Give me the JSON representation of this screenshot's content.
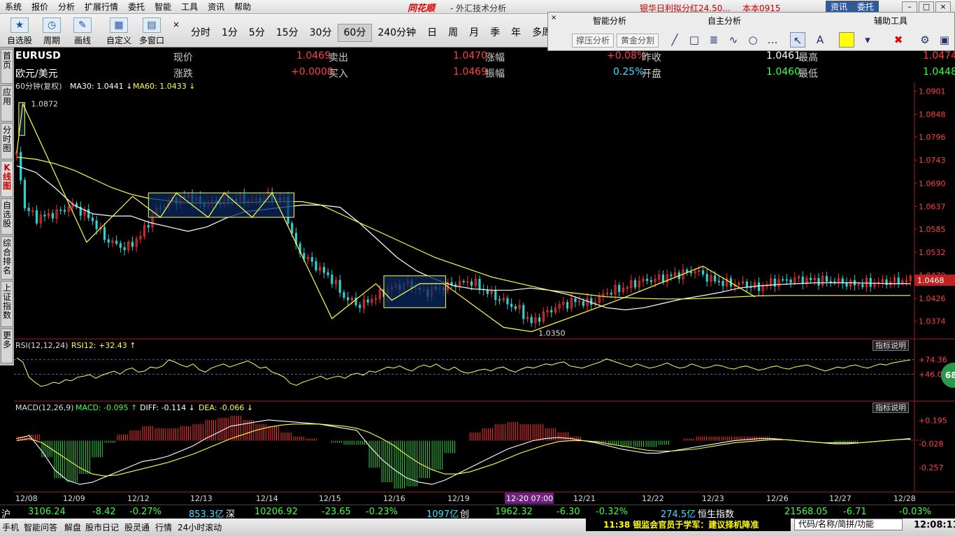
{
  "menu": [
    "系统",
    "报价",
    "分析",
    "扩展行情",
    "委托",
    "智能",
    "工具",
    "资讯",
    "帮助"
  ],
  "brand": "同花顺",
  "app_title": "- 外汇技术分析",
  "top_ticker": "银华日利拟分红24.50...",
  "top_ticker2": "本本0915",
  "top_buttons": {
    "news": "资讯",
    "order": "委托"
  },
  "toolbar": {
    "tools": [
      "自选股",
      "周期",
      "画线",
      "自定义",
      "多窗口"
    ],
    "periods": [
      "分时",
      "1分",
      "5分",
      "15分",
      "30分",
      "60分",
      "240分钟",
      "日",
      "周",
      "月",
      "季",
      "年",
      "多周期"
    ],
    "active_period": "60分"
  },
  "panel": {
    "headers": [
      "智能分析",
      "自主分析",
      "辅助工具"
    ],
    "buttons": [
      "撑压分析",
      "黄金分割"
    ]
  },
  "left_tabs": [
    "首页",
    "应用",
    "分时图",
    "K线图",
    "自选股",
    "综合排名",
    "上证指数",
    "更多"
  ],
  "quote": {
    "symbol": "EURUSD",
    "name": "欧元/美元",
    "row1": {
      "l1": "现价",
      "v1": "1.0469",
      "l2": "卖出",
      "v2": "1.0470",
      "l3": "涨幅",
      "v3": "+0.08%",
      "l4": "昨收",
      "v4": "1.0461",
      "l5": "最高",
      "v5": "1.0474"
    },
    "row2": {
      "l1": "涨跌",
      "v1": "+0.0008",
      "l2": "买入",
      "v2": "1.0469",
      "l3": "振幅",
      "v3": "0.25%",
      "l4": "开盘",
      "v4": "1.0460",
      "l5": "最低",
      "v5": "1.0448"
    }
  },
  "chart_labels": {
    "kline_title": "60分钟(复权)",
    "ma30": "MA30: 1.0441",
    "ma60": "MA60: 1.0433",
    "high_mark": "1.0872",
    "low_mark": "1.0350",
    "current_price": "1.0468",
    "rsi_title": "RSI(12,12,24)",
    "rsi_val": "RSI12: +32.43",
    "macd_title": "MACD(12,26,9)",
    "macd_val": "MACD: -0.095",
    "diff_val": "DIFF: -0.114",
    "dea_val": "DEA: -0.066",
    "indicator_btn": "指标说明",
    "rsi_badge": "68"
  },
  "chart_data": [
    {
      "type": "candlestick",
      "title": "60分钟(复权)",
      "price_ticks": [
        "1.0901",
        "1.0848",
        "1.0796",
        "1.0743",
        "1.0690",
        "1.0637",
        "1.0585",
        "1.0532",
        "1.0479",
        "1.0426",
        "1.0374"
      ],
      "ylim": [
        1.0335,
        1.0905
      ],
      "x_labels": [
        "12/08",
        "12/09",
        "12/12",
        "12/13",
        "12/14",
        "12/15",
        "12/16",
        "12/19",
        "12-20 07:00",
        "12/21",
        "12/22",
        "12/23",
        "12/26",
        "12/27",
        "12/28"
      ],
      "close_path": [
        [
          0,
          1.0755
        ],
        [
          1,
          1.0872
        ],
        [
          2,
          1.07
        ],
        [
          3,
          1.064
        ],
        [
          10,
          1.061
        ],
        [
          20,
          1.0622
        ],
        [
          28,
          1.064
        ],
        [
          37,
          1.061
        ],
        [
          45,
          1.056
        ],
        [
          55,
          1.054
        ],
        [
          62,
          1.057
        ],
        [
          70,
          1.063
        ],
        [
          78,
          1.065
        ],
        [
          86,
          1.066
        ],
        [
          94,
          1.064
        ],
        [
          102,
          1.065
        ],
        [
          110,
          1.0655
        ],
        [
          118,
          1.065
        ],
        [
          126,
          1.066
        ],
        [
          134,
          1.065
        ],
        [
          138,
          1.057
        ],
        [
          142,
          1.053
        ],
        [
          150,
          1.05
        ],
        [
          158,
          1.047
        ],
        [
          164,
          1.043
        ],
        [
          172,
          1.041
        ],
        [
          180,
          1.043
        ],
        [
          188,
          1.045
        ],
        [
          196,
          1.046
        ],
        [
          204,
          1.044
        ],
        [
          212,
          1.045
        ],
        [
          220,
          1.046
        ],
        [
          228,
          1.0465
        ],
        [
          236,
          1.044
        ],
        [
          244,
          1.042
        ],
        [
          252,
          1.04
        ],
        [
          258,
          1.037
        ],
        [
          264,
          1.039
        ],
        [
          272,
          1.041
        ],
        [
          280,
          1.042
        ],
        [
          288,
          1.0415
        ],
        [
          296,
          1.044
        ],
        [
          304,
          1.045
        ],
        [
          312,
          1.0465
        ],
        [
          320,
          1.047
        ],
        [
          330,
          1.048
        ],
        [
          340,
          1.049
        ],
        [
          348,
          1.047
        ],
        [
          356,
          1.046
        ],
        [
          364,
          1.046
        ],
        [
          372,
          1.045
        ],
        [
          380,
          1.0465
        ],
        [
          390,
          1.047
        ],
        [
          400,
          1.0468
        ],
        [
          410,
          1.0466
        ],
        [
          420,
          1.0458
        ],
        [
          430,
          1.0462
        ],
        [
          440,
          1.0466
        ],
        [
          448,
          1.0468
        ]
      ],
      "ma30": [
        1.073,
        1.0715,
        1.068,
        1.064,
        1.062,
        1.0615,
        1.0615,
        1.06,
        1.059,
        1.058,
        1.059,
        1.061,
        1.0625,
        1.063,
        1.0635,
        1.064,
        1.064,
        1.0635,
        1.06,
        1.056,
        1.052,
        1.049,
        1.047,
        1.0455,
        1.0448,
        1.0445,
        1.0445,
        1.045,
        1.0445,
        1.0435,
        1.042,
        1.0405,
        1.04,
        1.0405,
        1.0415,
        1.0425,
        1.0432,
        1.044,
        1.045,
        1.0455,
        1.0458,
        1.046,
        1.0462,
        1.0462,
        1.0462,
        1.0461,
        1.046,
        1.046
      ],
      "ma60": [
        1.075,
        1.0745,
        1.0735,
        1.072,
        1.07,
        1.068,
        1.0665,
        1.0655,
        1.065,
        1.0645,
        1.0645,
        1.0645,
        1.0646,
        1.0647,
        1.0648,
        1.0648,
        1.064,
        1.062,
        1.06,
        1.058,
        1.056,
        1.054,
        1.052,
        1.0505,
        1.049,
        1.0475,
        1.0465,
        1.0455,
        1.0445,
        1.044,
        1.0435,
        1.043,
        1.0428,
        1.0426,
        1.0425,
        1.0425,
        1.0426,
        1.0428,
        1.043,
        1.0432,
        1.0433,
        1.0433,
        1.0433,
        1.0433,
        1.0433,
        1.0433,
        1.0433,
        1.0433
      ],
      "zigzag": [
        [
          0,
          1.076
        ],
        [
          3,
          1.0872
        ],
        [
          35,
          1.0555
        ],
        [
          58,
          1.066
        ],
        [
          72,
          1.0612
        ],
        [
          80,
          1.0668
        ],
        [
          96,
          1.0612
        ],
        [
          104,
          1.0668
        ],
        [
          118,
          1.0612
        ],
        [
          128,
          1.0668
        ],
        [
          158,
          1.038
        ],
        [
          180,
          1.046
        ],
        [
          188,
          1.0422
        ],
        [
          202,
          1.046
        ],
        [
          214,
          1.046
        ],
        [
          244,
          1.036
        ],
        [
          258,
          1.035
        ],
        [
          300,
          1.042
        ],
        [
          344,
          1.05
        ],
        [
          370,
          1.043
        ]
      ],
      "boxes": [
        [
          1,
          1.0875,
          4,
          1.08
        ],
        [
          66,
          1.0668,
          139,
          1.0612
        ],
        [
          184,
          1.0478,
          215,
          1.0405
        ]
      ]
    },
    {
      "type": "line",
      "title": "RSI(12,12,24)",
      "y_ticks": [
        "+74.36",
        "+46.05"
      ],
      "ylim": [
        0,
        100
      ],
      "values": [
        78,
        70,
        40,
        30,
        22,
        25,
        30,
        28,
        35,
        33,
        40,
        42,
        45,
        38,
        44,
        48,
        52,
        46,
        55,
        58,
        50,
        52,
        60,
        58,
        62,
        74,
        70,
        64,
        60,
        66,
        55,
        50,
        58,
        62,
        66,
        60,
        64,
        68,
        72,
        66,
        58,
        60,
        50,
        46,
        40,
        28,
        24,
        30,
        34,
        38,
        42,
        36,
        40,
        42,
        38,
        45,
        48,
        44,
        52,
        50,
        55,
        60,
        58,
        62,
        56,
        52,
        60,
        64,
        60,
        66,
        58,
        54,
        60,
        52,
        48,
        50,
        54,
        56,
        52,
        58,
        60,
        54,
        50,
        56,
        60,
        58,
        62,
        66,
        64,
        68,
        70,
        62,
        60,
        58,
        62,
        66,
        70,
        76,
        72,
        68,
        64,
        60,
        66,
        62,
        58,
        60,
        64,
        68,
        62,
        58,
        60,
        66,
        62,
        58,
        60,
        64,
        62,
        58,
        56,
        60,
        62,
        58,
        54,
        56,
        60,
        62,
        58,
        56,
        60,
        62,
        64,
        60,
        56,
        52,
        56,
        60,
        58,
        62,
        64,
        60,
        58,
        62,
        66,
        64,
        68,
        70,
        72,
        74
      ]
    },
    {
      "type": "bar+line",
      "title": "MACD(12,26,9)",
      "y_ticks": [
        "+0.195",
        "-0.028",
        "-0.257"
      ],
      "ylim": [
        -0.46,
        0.3
      ],
      "diff": [
        0.02,
        0.05,
        -0.1,
        -0.28,
        -0.38,
        -0.42,
        -0.4,
        -0.35,
        -0.3,
        -0.25,
        -0.2,
        -0.18,
        -0.15,
        -0.1,
        -0.05,
        0.02,
        0.08,
        0.14,
        0.16,
        0.18,
        0.2,
        0.19,
        0.18,
        0.17,
        0.16,
        0.14,
        0.12,
        0.1,
        -0.05,
        -0.18,
        -0.28,
        -0.36,
        -0.4,
        -0.42,
        -0.38,
        -0.32,
        -0.26,
        -0.2,
        -0.14,
        -0.08,
        -0.04,
        0.0,
        0.02,
        0.03,
        0.02,
        0.0,
        -0.02,
        -0.05,
        -0.08,
        -0.1,
        -0.12,
        -0.12,
        -0.1,
        -0.08,
        -0.06,
        -0.04,
        -0.02,
        0.0,
        0.01,
        0.02,
        0.02,
        0.01,
        0.0,
        -0.01,
        -0.02,
        -0.03,
        -0.03,
        -0.02,
        -0.01,
        0.0,
        0.01,
        0.02
      ],
      "dea": [
        0.0,
        0.02,
        -0.02,
        -0.1,
        -0.18,
        -0.26,
        -0.32,
        -0.34,
        -0.33,
        -0.3,
        -0.27,
        -0.24,
        -0.21,
        -0.17,
        -0.13,
        -0.08,
        -0.03,
        0.02,
        0.06,
        0.1,
        0.13,
        0.15,
        0.16,
        0.16,
        0.16,
        0.15,
        0.14,
        0.12,
        0.08,
        0.02,
        -0.05,
        -0.14,
        -0.22,
        -0.28,
        -0.32,
        -0.32,
        -0.3,
        -0.26,
        -0.22,
        -0.17,
        -0.12,
        -0.08,
        -0.04,
        -0.01,
        0.0,
        0.0,
        -0.01,
        -0.03,
        -0.05,
        -0.07,
        -0.09,
        -0.1,
        -0.1,
        -0.09,
        -0.08,
        -0.06,
        -0.04,
        -0.02,
        -0.01,
        0.0,
        0.01,
        0.01,
        0.0,
        -0.01,
        -0.02,
        -0.02,
        -0.02,
        -0.02,
        -0.01,
        0.0,
        0.01,
        0.015
      ]
    }
  ],
  "status": {
    "sh_label": "沪",
    "sh_index": "3106.24",
    "sh_chg": "-8.42",
    "sh_pct": "-0.27%",
    "sh_amt": "853.3亿",
    "sz_label": "深",
    "sz_index": "10206.92",
    "sz_chg": "-23.65",
    "sz_pct": "-0.23%",
    "sz_amt": "1097亿",
    "cy_label": "创",
    "cy_index": "1962.32",
    "cy_chg": "-6.30",
    "cy_pct": "-0.32%",
    "cy_amt": "274.5亿",
    "hs_label": "恒生指数",
    "hs_index": "21568.05",
    "hs_chg": "-6.71",
    "hs_pct": "-0.03%"
  },
  "footer": {
    "items": [
      "手机",
      "智能问答",
      "解盘",
      "股市日记",
      "股灵通",
      "行情",
      "24小时滚动"
    ],
    "news": "11:38 银监会官员于学军：建议择机降准",
    "search_placeholder": "代码/名称/简拼/功能",
    "clock": "12:08:11"
  },
  "colors": {
    "up": "#ff3030",
    "down": "#30d0d0",
    "zigzag": "#ffff40",
    "box_fill": "#0a2a60"
  }
}
